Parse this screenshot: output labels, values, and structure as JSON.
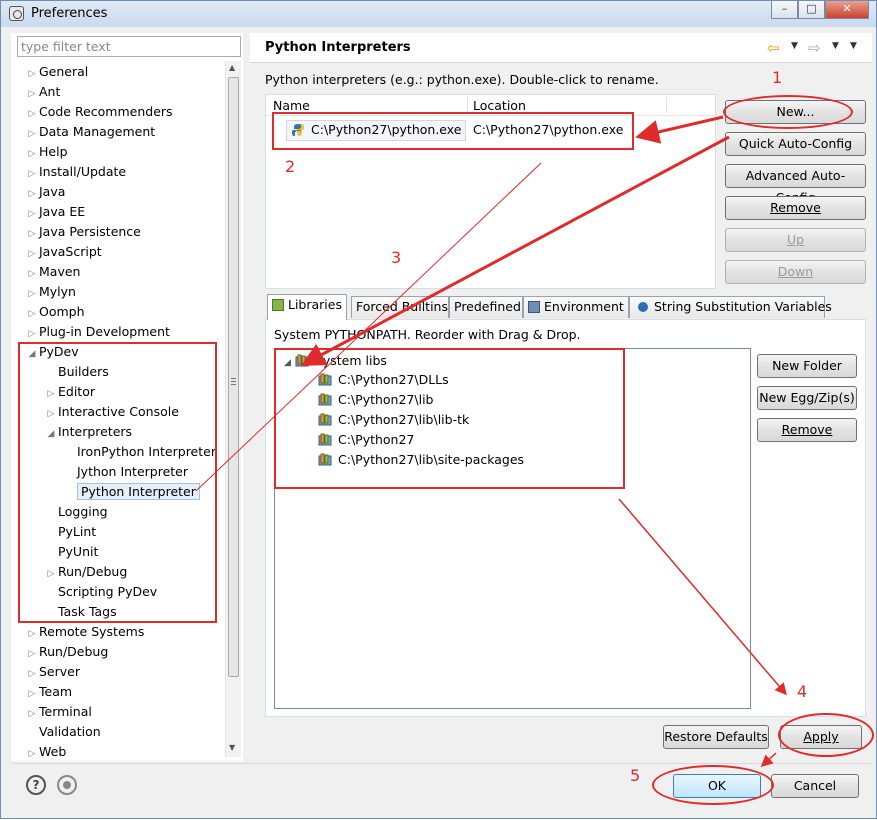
{
  "window": {
    "title": "Preferences"
  },
  "filter": {
    "placeholder": "type filter text"
  },
  "tree": [
    {
      "label": "General",
      "arrow": "▷"
    },
    {
      "label": "Ant",
      "arrow": "▷"
    },
    {
      "label": "Code Recommenders",
      "arrow": "▷"
    },
    {
      "label": "Data Management",
      "arrow": "▷"
    },
    {
      "label": "Help",
      "arrow": "▷"
    },
    {
      "label": "Install/Update",
      "arrow": "▷"
    },
    {
      "label": "Java",
      "arrow": "▷"
    },
    {
      "label": "Java EE",
      "arrow": "▷"
    },
    {
      "label": "Java Persistence",
      "arrow": "▷"
    },
    {
      "label": "JavaScript",
      "arrow": "▷"
    },
    {
      "label": "Maven",
      "arrow": "▷"
    },
    {
      "label": "Mylyn",
      "arrow": "▷"
    },
    {
      "label": "Oomph",
      "arrow": "▷"
    },
    {
      "label": "Plug-in Development",
      "arrow": "▷"
    },
    {
      "label": "PyDev",
      "arrow": "◢"
    },
    {
      "label": "Builders",
      "arrow": ""
    },
    {
      "label": "Editor",
      "arrow": "▷"
    },
    {
      "label": "Interactive Console",
      "arrow": "▷"
    },
    {
      "label": "Interpreters",
      "arrow": "◢"
    },
    {
      "label": "IronPython Interpreter",
      "arrow": ""
    },
    {
      "label": "Jython Interpreter",
      "arrow": ""
    },
    {
      "label": "Python Interpreter",
      "arrow": ""
    },
    {
      "label": "Logging",
      "arrow": ""
    },
    {
      "label": "PyLint",
      "arrow": ""
    },
    {
      "label": "PyUnit",
      "arrow": ""
    },
    {
      "label": "Run/Debug",
      "arrow": "▷"
    },
    {
      "label": "Scripting PyDev",
      "arrow": ""
    },
    {
      "label": "Task Tags",
      "arrow": ""
    },
    {
      "label": "Remote Systems",
      "arrow": "▷"
    },
    {
      "label": "Run/Debug",
      "arrow": "▷"
    },
    {
      "label": "Server",
      "arrow": "▷"
    },
    {
      "label": "Team",
      "arrow": "▷"
    },
    {
      "label": "Terminal",
      "arrow": "▷"
    },
    {
      "label": "Validation",
      "arrow": ""
    },
    {
      "label": "Web",
      "arrow": "▷"
    }
  ],
  "page": {
    "title": "Python Interpreters",
    "description": "Python interpreters (e.g.: python.exe).   Double-click to rename."
  },
  "interpreters_table": {
    "headers": {
      "name": "Name",
      "location": "Location"
    },
    "rows": [
      {
        "name": "C:\\Python27\\python.exe",
        "location": "C:\\Python27\\python.exe"
      }
    ]
  },
  "buttons": {
    "new": "New...",
    "quick_auto": "Quick Auto-Config",
    "advanced_auto": "Advanced Auto-Config",
    "remove": "Remove",
    "up": "Up",
    "down": "Down",
    "new_folder": "New Folder",
    "new_egg": "New Egg/Zip(s)",
    "lib_remove": "Remove",
    "restore_defaults": "Restore Defaults",
    "apply": "Apply",
    "ok": "OK",
    "cancel": "Cancel"
  },
  "tabs": [
    "Libraries",
    "Forced Builtins",
    "Predefined",
    "Environment",
    "String Substitution Variables"
  ],
  "libraries": {
    "note": "System PYTHONPATH.   Reorder with Drag & Drop.",
    "root": "System libs",
    "items": [
      "C:\\Python27\\DLLs",
      "C:\\Python27\\lib",
      "C:\\Python27\\lib\\lib-tk",
      "C:\\Python27",
      "C:\\Python27\\lib\\site-packages"
    ]
  },
  "annotations": [
    "1",
    "2",
    "3",
    "4",
    "5"
  ],
  "colors": {
    "annotation": "#e02b2b",
    "selection": "#e5f0fb",
    "default_button": "#bee6fd"
  }
}
